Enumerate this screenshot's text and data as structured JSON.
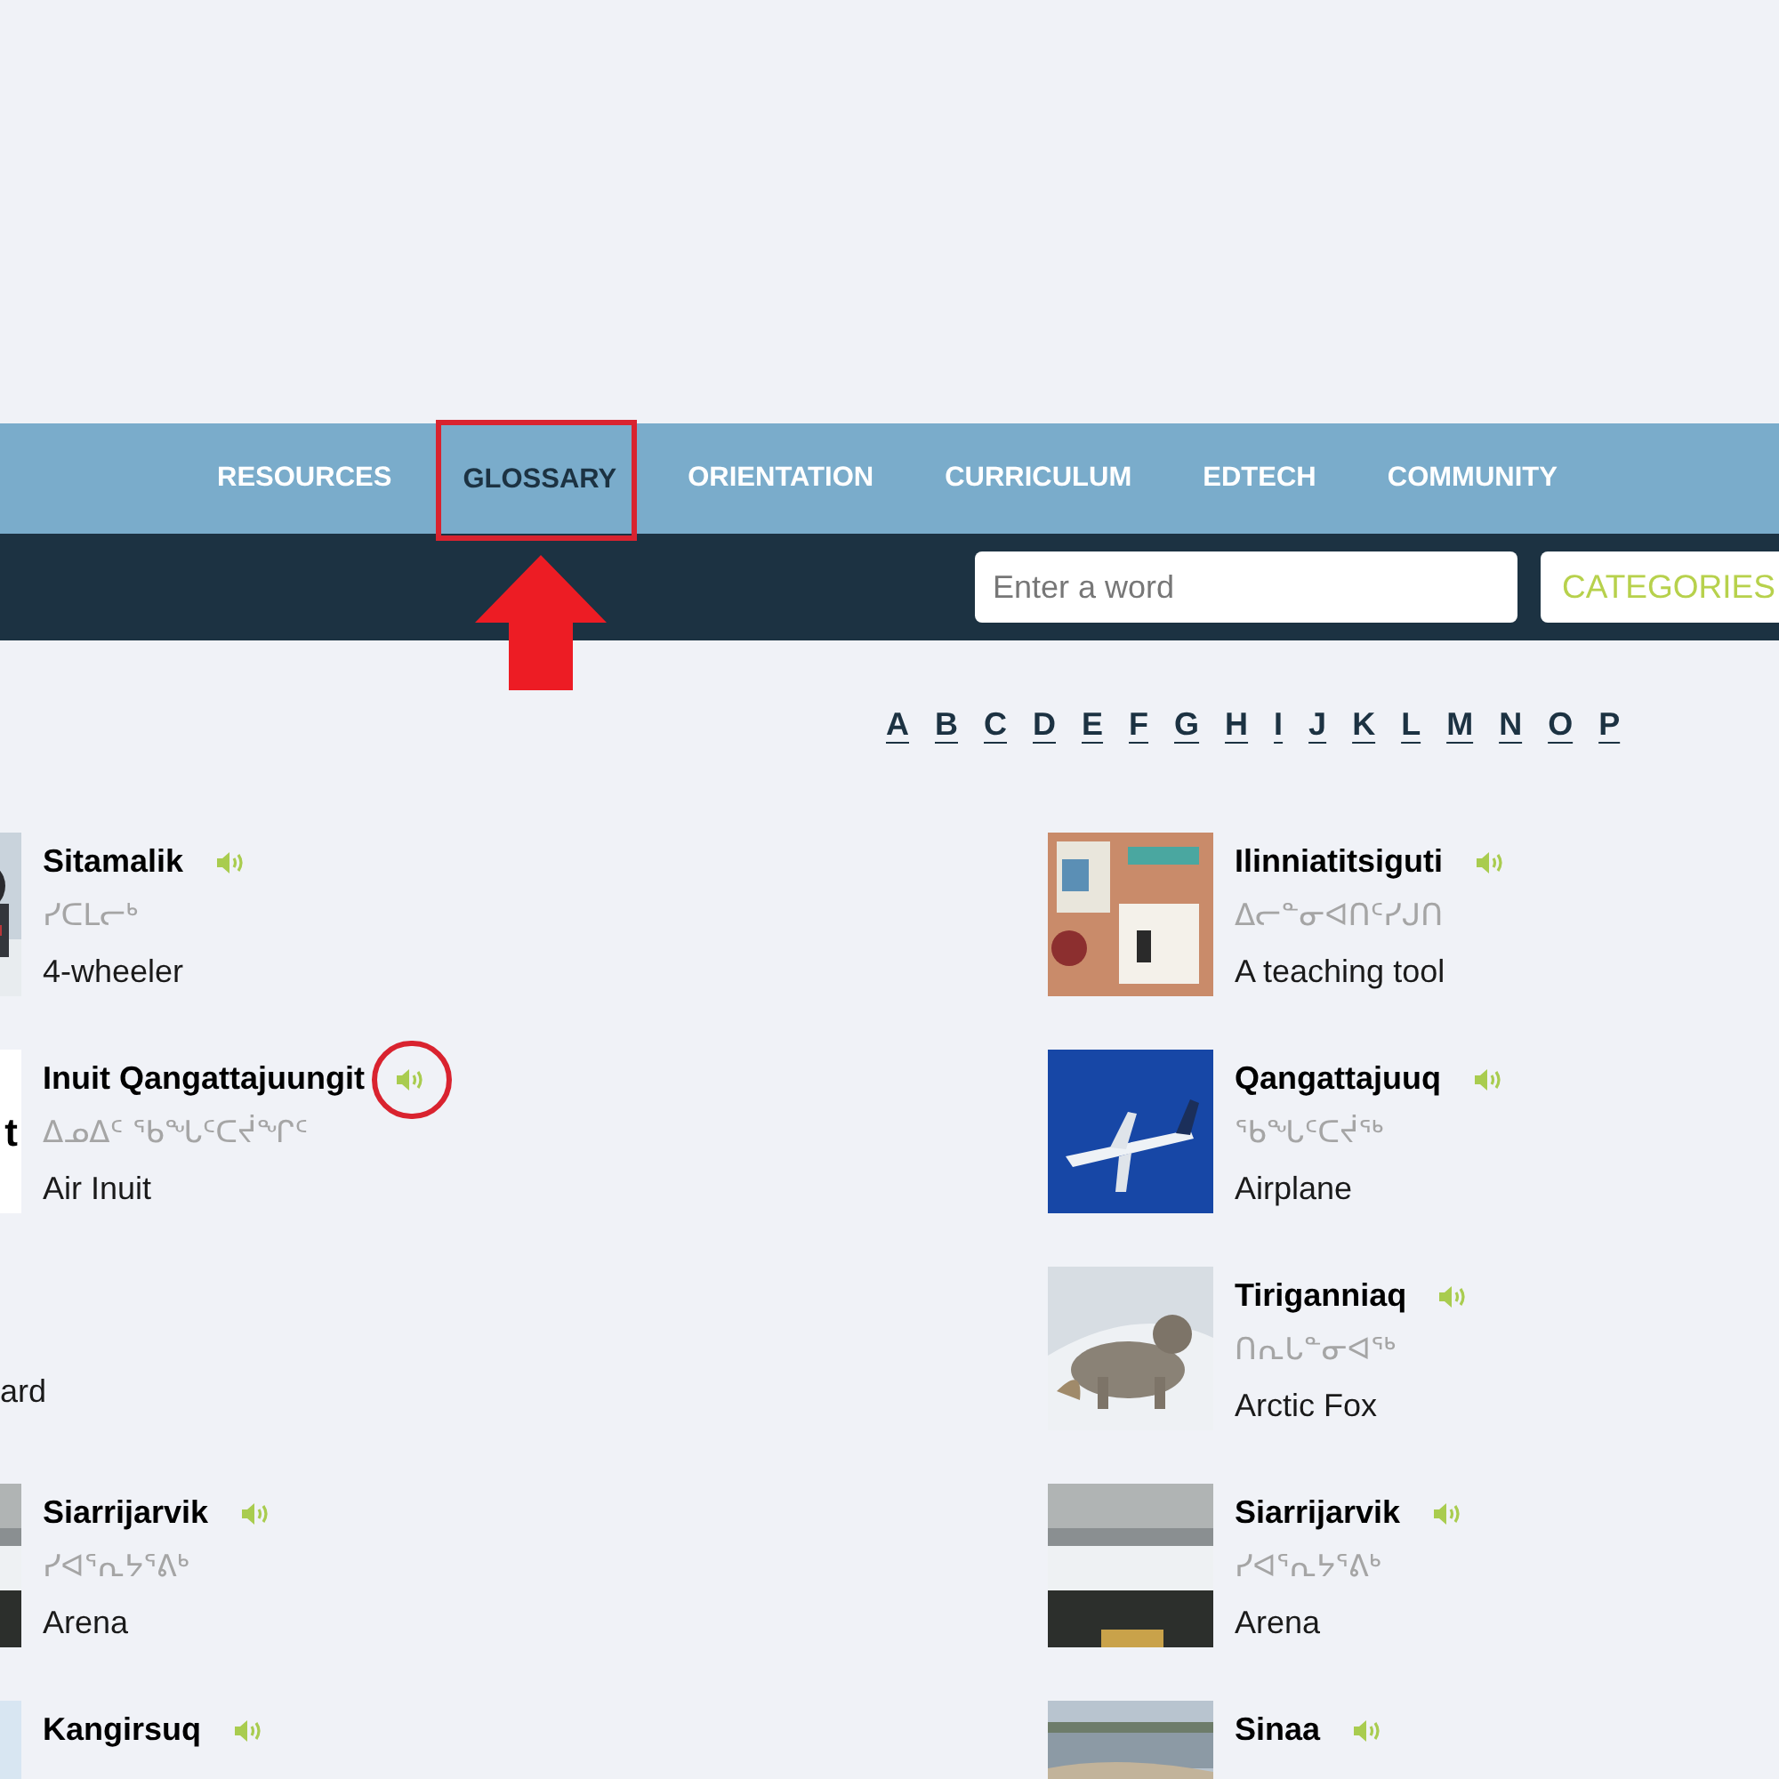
{
  "nav": {
    "items": [
      {
        "label": "RESOURCES",
        "selected": false,
        "highlighted": false
      },
      {
        "label": "GLOSSARY",
        "selected": true,
        "highlighted": true
      },
      {
        "label": "ORIENTATION",
        "selected": false,
        "highlighted": false
      },
      {
        "label": "CURRICULUM",
        "selected": false,
        "highlighted": false
      },
      {
        "label": "EDTECH",
        "selected": false,
        "highlighted": false
      },
      {
        "label": "COMMUNITY",
        "selected": false,
        "highlighted": false
      }
    ]
  },
  "search": {
    "placeholder": "Enter a word",
    "categories_button": "CATEGORIES"
  },
  "alphabet": [
    "A",
    "B",
    "C",
    "D",
    "E",
    "F",
    "G",
    "H",
    "I",
    "J",
    "K",
    "L",
    "M",
    "N",
    "O",
    "P"
  ],
  "columns": [
    [
      {
        "kind": "entry",
        "name": "Sitamalik",
        "syllabics": "ᓯᑕᒪᓕᒃ",
        "translation": "4-wheeler",
        "audio_highlighted": false
      },
      {
        "kind": "entry",
        "image": {
          "kind": "logo",
          "text": "t"
        },
        "name": "Inuit Qangattajuungit",
        "syllabics": "ᐃᓄᐃᑦ ᖃᖓᑦᑕᔫᖏᑦ",
        "translation": "Air Inuit",
        "audio_highlighted": true
      },
      {
        "kind": "fragment",
        "translation": "ard"
      },
      {
        "kind": "entry",
        "name": "Siarrijarvik",
        "syllabics": "ᓯᐊᕐᕆᔭᕐᕕᒃ",
        "translation": "Arena",
        "audio_highlighted": false
      },
      {
        "kind": "entry",
        "name": "Kangirsuq",
        "audio_highlighted": false
      }
    ],
    [
      {
        "kind": "entry",
        "name": "Ilinniatitsiguti",
        "syllabics": "ᐃᓕᓐᓂᐊᑎᑦᓯᒍᑎ",
        "translation": "A teaching tool",
        "audio_highlighted": false
      },
      {
        "kind": "entry",
        "name": "Qangattajuuq",
        "syllabics": "ᖃᖓᑦᑕᔫᖅ",
        "translation": "Airplane",
        "audio_highlighted": false
      },
      {
        "kind": "entry",
        "name": "Tiriganniaq",
        "syllabics": "ᑎᕆᒐᓐᓂᐊᖅ",
        "translation": "Arctic Fox",
        "audio_highlighted": false
      },
      {
        "kind": "entry",
        "name": "Siarrijarvik",
        "syllabics": "ᓯᐊᕐᕆᔭᕐᕕᒃ",
        "translation": "Arena",
        "audio_highlighted": false
      },
      {
        "kind": "entry",
        "name": "Sinaa",
        "audio_highlighted": false
      }
    ]
  ]
}
